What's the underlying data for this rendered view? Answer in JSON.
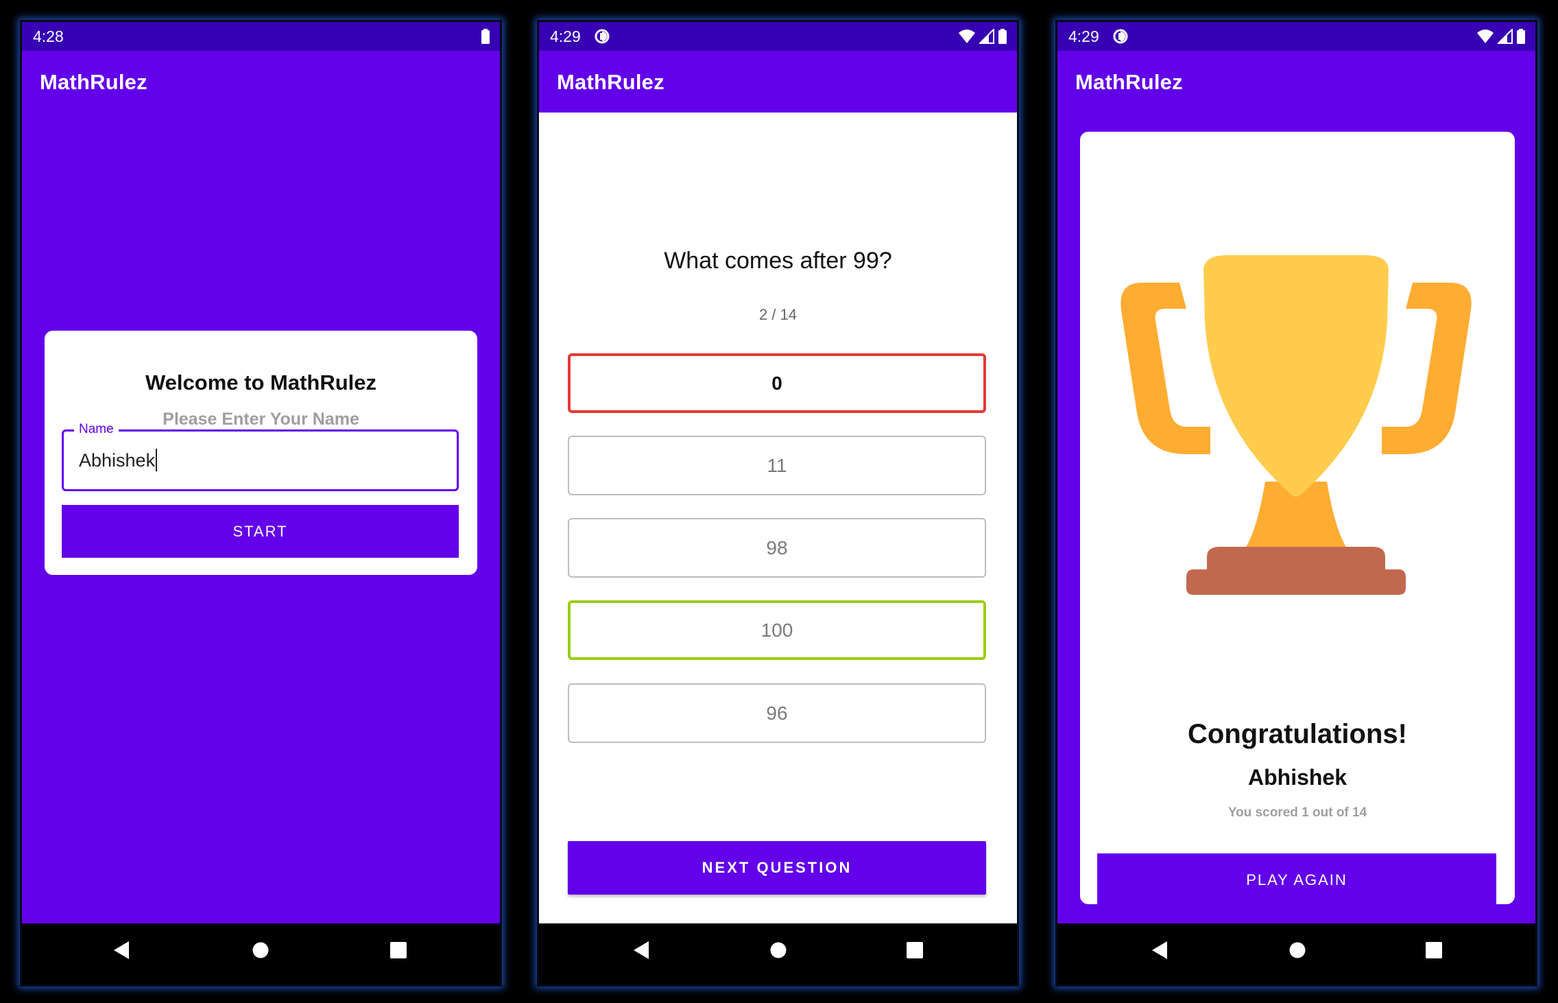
{
  "colors": {
    "primary": "#6200ea",
    "status_bar": "#3700b3",
    "wrong_border": "#e53935",
    "correct_border": "#9acd12",
    "trophy_cup": "#ffcc4d",
    "trophy_handles": "#ffac33",
    "trophy_base": "#c1694f"
  },
  "screen1": {
    "status_time": "4:28",
    "status_icons": [
      "battery-icon"
    ],
    "app_title": "MathRulez",
    "welcome_title": "Welcome to MathRulez",
    "welcome_subtitle": "Please Enter Your Name",
    "name_field": {
      "label": "Name",
      "value": "Abhishek"
    },
    "start_label": "START"
  },
  "screen2": {
    "status_time": "4:29",
    "status_icons": [
      "sync-icon",
      "wifi-icon",
      "signal-icon",
      "battery-icon"
    ],
    "app_title": "MathRulez",
    "question": "What comes after 99?",
    "progress": "2 / 14",
    "options": [
      {
        "label": "0",
        "state": "wrong"
      },
      {
        "label": "11",
        "state": "default"
      },
      {
        "label": "98",
        "state": "default"
      },
      {
        "label": "100",
        "state": "correct"
      },
      {
        "label": "96",
        "state": "default"
      }
    ],
    "next_label": "NEXT QUESTION"
  },
  "screen3": {
    "status_time": "4:29",
    "status_icons": [
      "sync-icon",
      "wifi-icon",
      "signal-icon",
      "battery-icon"
    ],
    "app_title": "MathRulez",
    "image_icon": "trophy-icon",
    "congrats": "Congratulations!",
    "player_name": "Abhishek",
    "score": "You scored 1 out of 14",
    "play_again_label": "PLAY AGAIN"
  },
  "nav_icons": [
    "back-icon",
    "home-icon",
    "recents-icon"
  ]
}
